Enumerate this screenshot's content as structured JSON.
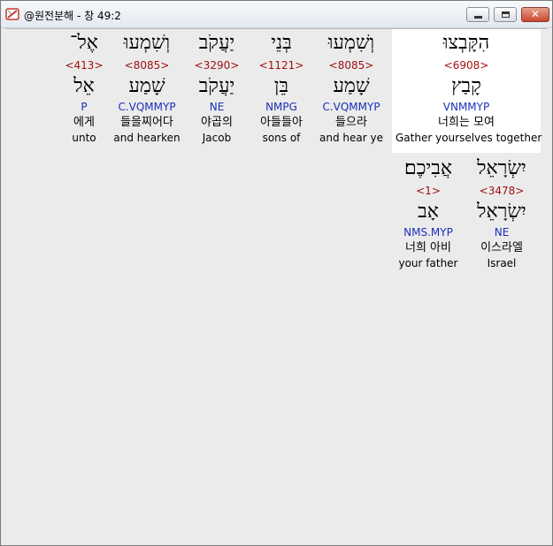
{
  "window": {
    "title": "@원전분해 - 창 49:2",
    "close_label": "✕"
  },
  "row1": [
    {
      "heb": "הִקָּבְצוּ",
      "strong": "<6908>",
      "lemma": "קָבַץ",
      "morph": "VNMMYP",
      "kor": "너희는 모여",
      "eng": "Gather yourselves together"
    },
    {
      "heb": "וְשִׁמְעוּ",
      "strong": "<8085>",
      "lemma": "שָׁמַע",
      "morph": "C.VQMMYP",
      "kor": "들으라",
      "eng": "and hear ye"
    },
    {
      "heb": "בְּנֵי",
      "strong": "<1121>",
      "lemma": "בֵּן",
      "morph": "NMPG",
      "kor": "아들들아",
      "eng": "sons of"
    },
    {
      "heb": "יַעֲקֹב",
      "strong": "<3290>",
      "lemma": "יַעֲקֹב",
      "morph": "NE",
      "kor": "야곱의",
      "eng": "Jacob"
    },
    {
      "heb": "וְשִׁמְעוּ",
      "strong": "<8085>",
      "lemma": "שָׁמַע",
      "morph": "C.VQMMYP",
      "kor": "들을찌어다",
      "eng": "and hearken"
    },
    {
      "heb": "אֶל־",
      "strong": "<413>",
      "lemma": "אֵל",
      "morph": "P",
      "kor": "에게",
      "eng": "unto"
    }
  ],
  "row2": [
    {
      "heb": "יִשְׂרָאֵל",
      "strong": "<3478>",
      "lemma": "יִשְׂרָאֵל",
      "morph": "NE",
      "kor": "이스라엘",
      "eng": "Israel"
    },
    {
      "heb": "אֲבִיכֶם׃",
      "strong": "<1>",
      "lemma": "אָב",
      "morph": "NMS.MYP",
      "kor": "너희 아비",
      "eng": "your father"
    }
  ]
}
